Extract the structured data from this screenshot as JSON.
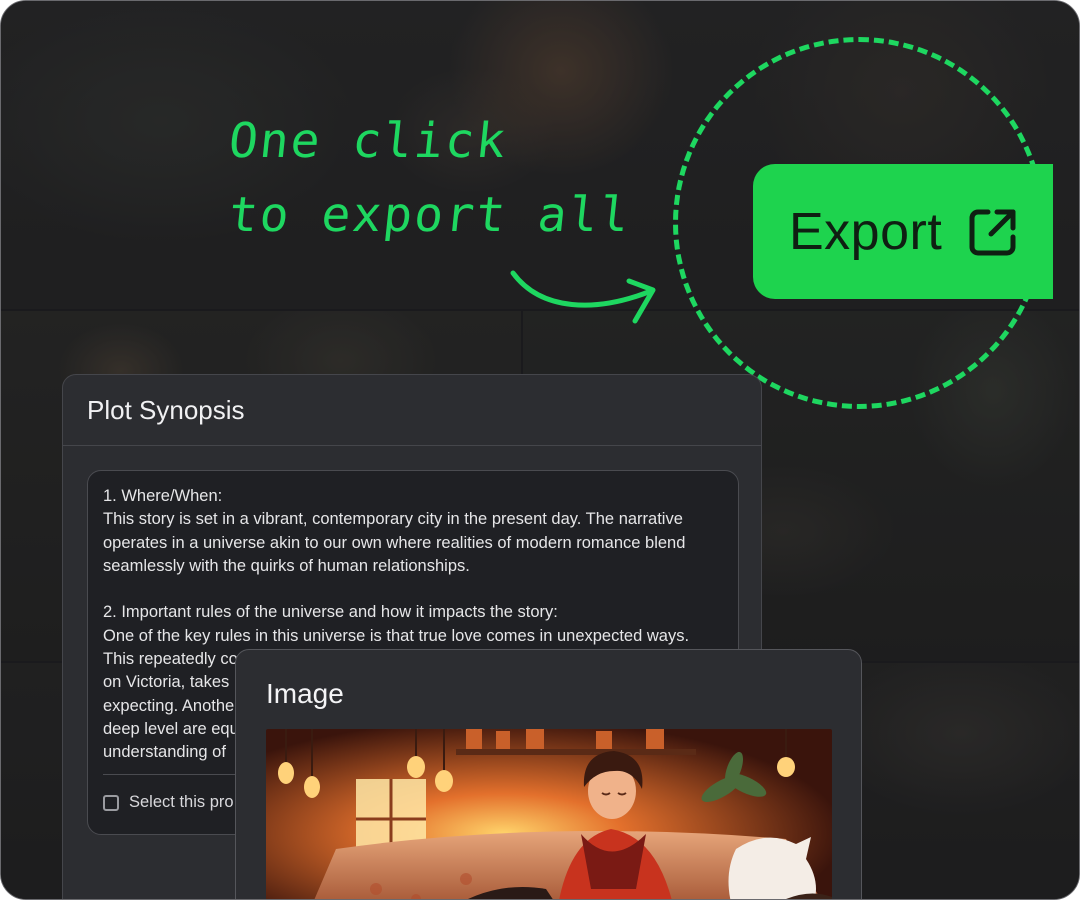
{
  "annotation": {
    "line1": "One click",
    "line2": "to export all",
    "accent_color": "#1ed760"
  },
  "export_button": {
    "label": "Export",
    "icon": "external-link-icon",
    "color": "#1ed34e"
  },
  "plot_synopsis": {
    "title": "Plot Synopsis",
    "paragraphs": [
      " 1. Where/When:",
      "This story is set in a vibrant, contemporary city in the present day. The narrative operates in a universe akin to our own where realities of modern romance blend seamlessly with the quirks of human relationships.",
      "",
      "2. Important rules of the universe and how it impacts the story:",
      "One of the key rules in this universe is that true love comes in unexpected ways. This repeatedly co",
      "on Victoria, takes",
      "expecting. Anothe",
      "deep level are equ",
      "understanding of"
    ],
    "checkbox_label": "Select this pro"
  },
  "image_card": {
    "title": "Image"
  }
}
